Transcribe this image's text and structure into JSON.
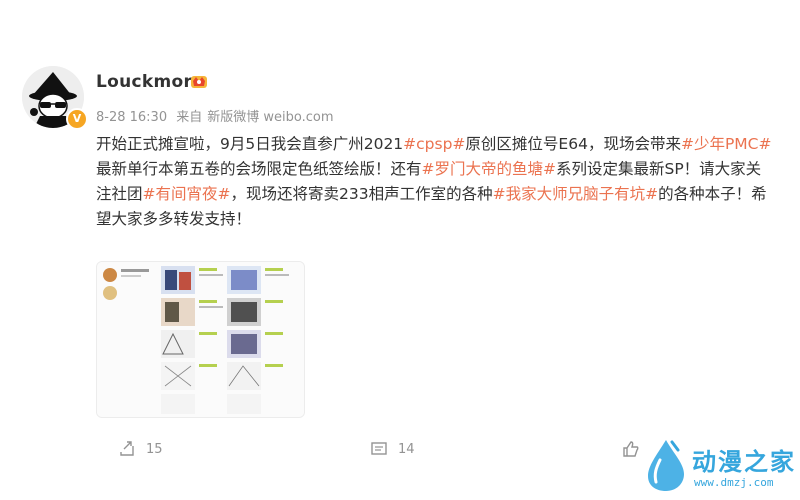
{
  "post": {
    "author": "Louckmor",
    "verified_badge": "V",
    "time": "8-28 16:30",
    "source_prefix": "来自",
    "source": "新版微博 weibo.com",
    "content": [
      {
        "t": "开始正式摊宣啦，9月5日我会直参广州2021"
      },
      {
        "t": "#cpsp#",
        "tag": true
      },
      {
        "t": "原创区摊位号E64，现场会带来"
      },
      {
        "t": "#少年PMC#",
        "tag": true
      },
      {
        "t": "最新单行本第五卷的会场限定色纸签绘版！还有"
      },
      {
        "t": "#罗门大帝的鱼塘#",
        "tag": true
      },
      {
        "t": "系列设定集最新SP！请大家关注社团"
      },
      {
        "t": "#有间宵夜#",
        "tag": true
      },
      {
        "t": "，现场还将寄卖233相声工作室的各种"
      },
      {
        "t": "#我家大师兄脑子有坑#",
        "tag": true
      },
      {
        "t": "的各种本子！希望大家多多转发支持！"
      }
    ]
  },
  "actions": {
    "repost_count": "15",
    "comment_count": "14",
    "like_count": ""
  },
  "watermark": {
    "title": "动漫之家",
    "url": "www.dmzj.com"
  },
  "colors": {
    "tag": "#eb7350",
    "meta": "#939393",
    "watermark": "#36a6dd"
  }
}
